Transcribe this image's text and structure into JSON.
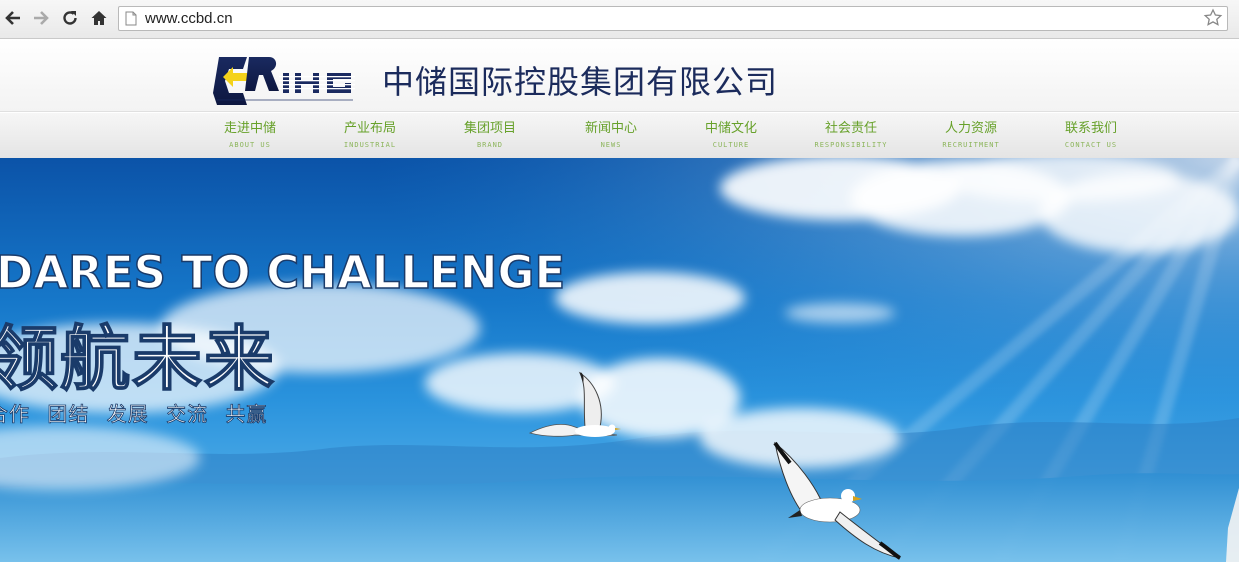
{
  "browser": {
    "url": "www.ccbd.cn"
  },
  "site": {
    "logo_text": "CRIHG",
    "company_name": "中储国际控股集团有限公司"
  },
  "nav": [
    {
      "cn": "走进中储",
      "en": "ABOUT US"
    },
    {
      "cn": "产业布局",
      "en": "INDUSTRIAL"
    },
    {
      "cn": "集团项目",
      "en": "BRAND"
    },
    {
      "cn": "新闻中心",
      "en": "NEWS"
    },
    {
      "cn": "中储文化",
      "en": "CULTURE"
    },
    {
      "cn": "社会责任",
      "en": "RESPONSIBILITY"
    },
    {
      "cn": "人力资源",
      "en": "RECRUITMENT"
    },
    {
      "cn": "联系我们",
      "en": "CONTACT US"
    }
  ],
  "banner": {
    "slogan_en": "DARES TO CHALLENGE",
    "slogan_cn": "领航未来",
    "values": "合作 团结 发展 交流 共赢"
  },
  "colors": {
    "nav_text": "#67a12a",
    "company_name": "#1b2b5c",
    "banner_sky": "#1677c9"
  }
}
